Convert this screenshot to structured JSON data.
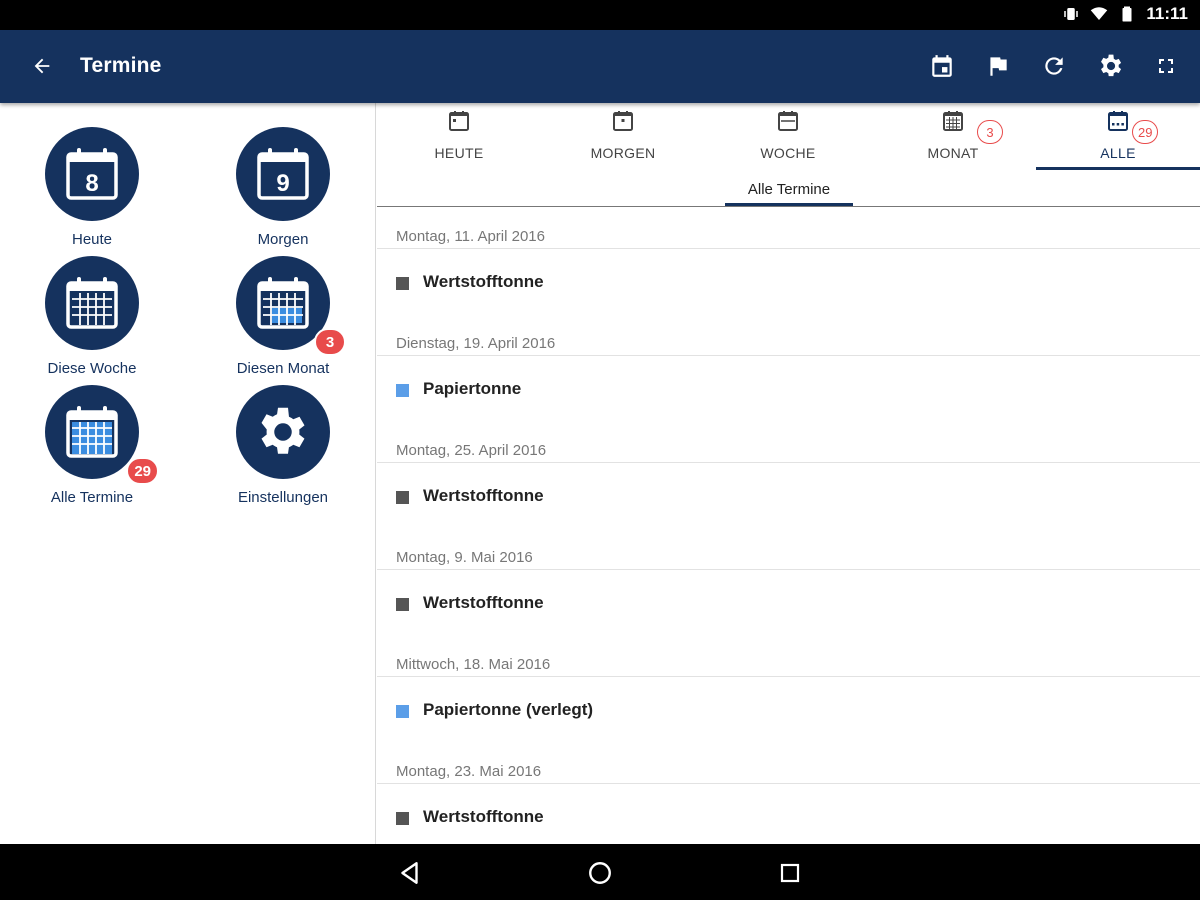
{
  "status_bar": {
    "time": "11:11"
  },
  "toolbar": {
    "title": "Termine",
    "actions": [
      "calendar-event-icon",
      "flag-icon",
      "refresh-icon",
      "settings-icon",
      "fullscreen-icon"
    ]
  },
  "tiles": [
    {
      "label": "Heute",
      "day": "8",
      "icon": "calendar-day-icon",
      "badge": ""
    },
    {
      "label": "Morgen",
      "day": "9",
      "icon": "calendar-day-icon",
      "badge": ""
    },
    {
      "label": "Diese Woche",
      "icon": "calendar-week-icon",
      "badge": ""
    },
    {
      "label": "Diesen Monat",
      "icon": "calendar-month-icon",
      "badge": "3"
    },
    {
      "label": "Alle Termine",
      "icon": "calendar-all-icon",
      "badge": "29"
    },
    {
      "label": "Einstellungen",
      "icon": "settings-gear-icon",
      "badge": ""
    }
  ],
  "tabs": [
    {
      "label": "HEUTE",
      "badge": ""
    },
    {
      "label": "MORGEN",
      "badge": ""
    },
    {
      "label": "WOCHE",
      "badge": ""
    },
    {
      "label": "MONAT",
      "badge": "3"
    },
    {
      "label": "ALLE",
      "badge": "29"
    }
  ],
  "active_tab": "ALLE",
  "subtab": {
    "label": "Alle Termine"
  },
  "entries": [
    {
      "date": "Montag, 11. April 2016",
      "name": "Wertstofftonne",
      "color": "#555555"
    },
    {
      "date": "Dienstag, 19. April 2016",
      "name": "Papiertonne",
      "color": "#5b9ee8"
    },
    {
      "date": "Montag, 25. April 2016",
      "name": "Wertstofftonne",
      "color": "#555555"
    },
    {
      "date": "Montag, 9. Mai 2016",
      "name": "Wertstofftonne",
      "color": "#555555"
    },
    {
      "date": "Mittwoch, 18. Mai 2016",
      "name": "Papiertonne (verlegt)",
      "color": "#5b9ee8"
    },
    {
      "date": "Montag, 23. Mai 2016",
      "name": "Wertstofftonne",
      "color": "#555555"
    }
  ],
  "colors": {
    "primary": "#15325e",
    "badge": "#e84b4b",
    "grid_accent": "#3b8de0"
  }
}
